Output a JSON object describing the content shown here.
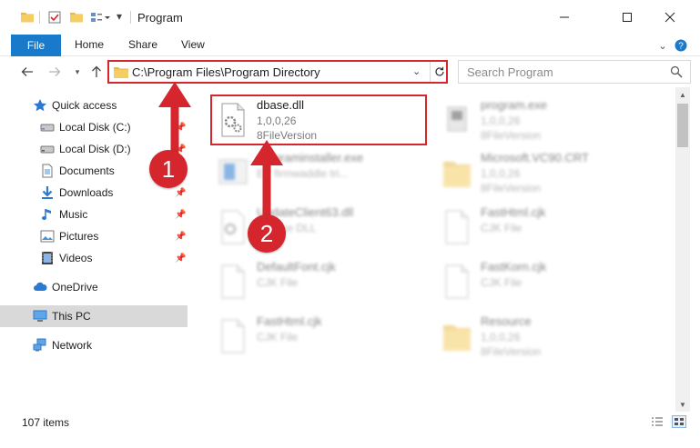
{
  "window": {
    "title": "Program",
    "minimize_icon": "minimize-icon",
    "maximize_icon": "maximize-icon",
    "close_icon": "close-icon"
  },
  "ribbon": {
    "file_label": "File",
    "tabs": [
      "Home",
      "Share",
      "View"
    ]
  },
  "address": {
    "path": "C:\\Program Files\\Program Directory",
    "search_placeholder": "Search Program"
  },
  "sidebar": {
    "items": [
      {
        "label": "Quick access",
        "icon": "star-icon"
      },
      {
        "label": "Local Disk (C:)",
        "icon": "drive-icon",
        "pinned": true
      },
      {
        "label": "Local Disk (D:)",
        "icon": "drive-icon",
        "pinned": true
      },
      {
        "label": "Documents",
        "icon": "documents-icon",
        "pinned": true
      },
      {
        "label": "Downloads",
        "icon": "downloads-icon",
        "pinned": true
      },
      {
        "label": "Music",
        "icon": "music-icon",
        "pinned": true
      },
      {
        "label": "Pictures",
        "icon": "pictures-icon",
        "pinned": true
      },
      {
        "label": "Videos",
        "icon": "videos-icon",
        "pinned": true
      },
      {
        "label": "OneDrive",
        "icon": "cloud-icon"
      },
      {
        "label": "This PC",
        "icon": "computer-icon",
        "selected": true
      },
      {
        "label": "Network",
        "icon": "network-icon"
      }
    ]
  },
  "files": {
    "left": [
      {
        "name": "dbase.dll",
        "line1": "1,0,0,26",
        "line2": "8FileVersion"
      },
      {
        "name": "programinstaller.exe",
        "line1": "EY firmwaddle tri..."
      },
      {
        "name": "UpdateClient63.dll",
        "line1": "Service DLL"
      },
      {
        "name": "DefaultFont.cjk",
        "line1": "CJK File"
      },
      {
        "name": "FastHtml.cjk",
        "line1": "CJK File"
      }
    ],
    "right": [
      {
        "name": "program.exe",
        "line1": "1,0,0,26",
        "line2": "8FileVersion"
      },
      {
        "name": "Microsoft.VC90.CRT",
        "line1": "1,0,0,26",
        "line2": "8FileVersion"
      },
      {
        "name": "FastHtml.cjk",
        "line1": "CJK File"
      },
      {
        "name": "FastKorn.cjk",
        "line1": "CJK File"
      },
      {
        "name": "Resource",
        "line1": "1,0,0,26",
        "line2": "8FileVersion"
      }
    ]
  },
  "status": {
    "item_count": "107 items"
  },
  "annotations": {
    "step1": "1",
    "step2": "2"
  },
  "colors": {
    "accent_blue": "#1979ca",
    "annotation_red": "#d4262c",
    "selected_bg": "#d9d9d9"
  }
}
